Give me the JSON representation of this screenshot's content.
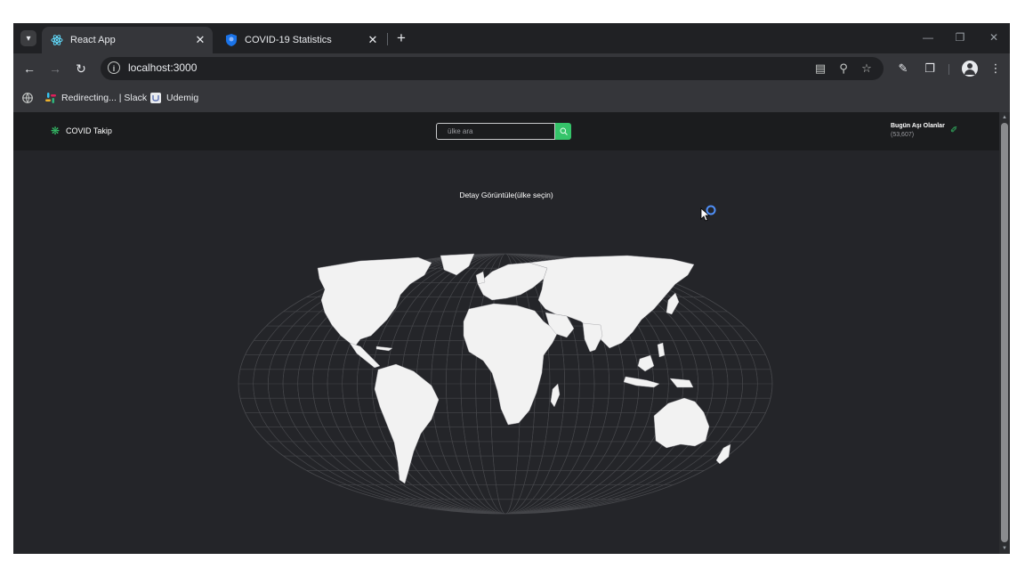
{
  "browser": {
    "tabs": [
      {
        "title": "React App",
        "active": true
      },
      {
        "title": "COVID-19 Statistics",
        "active": false
      }
    ],
    "url": "localhost:3000",
    "bookmarks": [
      {
        "label": "Redirecting... | Slack",
        "icon": "slack-icon"
      },
      {
        "label": "Udemig",
        "icon": "udemig-icon"
      }
    ]
  },
  "app": {
    "brand": "COVID Takip",
    "search": {
      "placeholder": "ülke ara"
    },
    "vaccinated": {
      "label": "Bugün Aşı Olanlar",
      "count": "(53,607)"
    },
    "detail_prompt": "Detay Görüntüle(ülke seçin)"
  },
  "colors": {
    "accent": "#35c46a",
    "page_bg": "#242529",
    "nav_bg": "#1b1c1e",
    "land": "#f2f2f2",
    "graticule": "#46474b"
  }
}
